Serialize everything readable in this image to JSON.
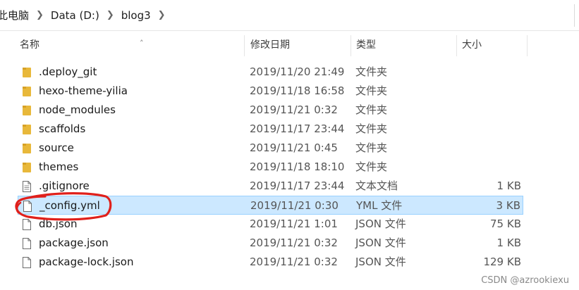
{
  "breadcrumb": [
    {
      "label": "此电脑"
    },
    {
      "label": "Data (D:)"
    },
    {
      "label": "blog3"
    }
  ],
  "columns": {
    "name": "名称",
    "date": "修改日期",
    "type": "类型",
    "size": "大小"
  },
  "files": [
    {
      "name": ".deploy_git",
      "date": "2019/11/20 21:49",
      "type": "文件夹",
      "size": "",
      "icon": "folder-icon"
    },
    {
      "name": "hexo-theme-yilia",
      "date": "2019/11/18 16:58",
      "type": "文件夹",
      "size": "",
      "icon": "folder-icon"
    },
    {
      "name": "node_modules",
      "date": "2019/11/21 0:32",
      "type": "文件夹",
      "size": "",
      "icon": "folder-icon"
    },
    {
      "name": "scaffolds",
      "date": "2019/11/17 23:44",
      "type": "文件夹",
      "size": "",
      "icon": "folder-icon"
    },
    {
      "name": "source",
      "date": "2019/11/21 0:45",
      "type": "文件夹",
      "size": "",
      "icon": "folder-icon"
    },
    {
      "name": "themes",
      "date": "2019/11/18 18:10",
      "type": "文件夹",
      "size": "",
      "icon": "folder-icon"
    },
    {
      "name": ".gitignore",
      "date": "2019/11/17 23:44",
      "type": "文本文档",
      "size": "1 KB",
      "icon": "text-file-icon"
    },
    {
      "name": "_config.yml",
      "date": "2019/11/21 0:30",
      "type": "YML 文件",
      "size": "3 KB",
      "icon": "file-icon",
      "selected": true
    },
    {
      "name": "db.json",
      "date": "2019/11/21 1:01",
      "type": "JSON 文件",
      "size": "75 KB",
      "icon": "file-icon"
    },
    {
      "name": "package.json",
      "date": "2019/11/21 0:32",
      "type": "JSON 文件",
      "size": "1 KB",
      "icon": "file-icon"
    },
    {
      "name": "package-lock.json",
      "date": "2019/11/21 0:32",
      "type": "JSON 文件",
      "size": "129 KB",
      "icon": "file-icon"
    }
  ],
  "watermark": "CSDN @azrookiexu",
  "colors": {
    "folder": "#e8b83a",
    "selection": "#cce8ff",
    "selection_border": "#99d1ff",
    "annotation": "#e0201b"
  }
}
